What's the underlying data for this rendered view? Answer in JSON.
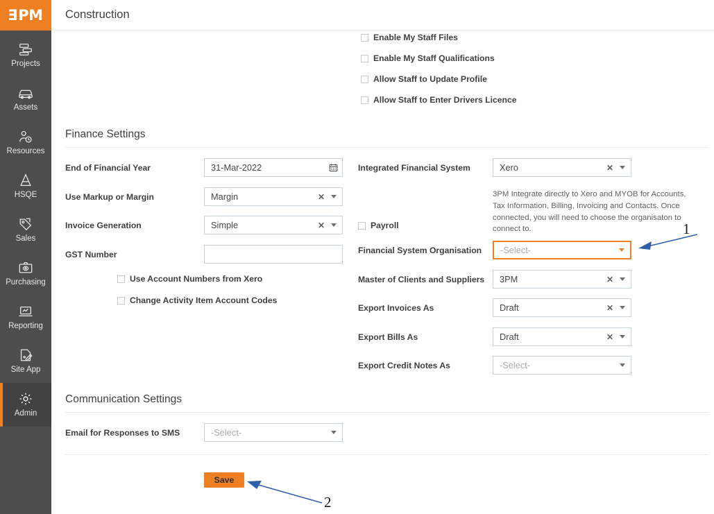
{
  "brand": {
    "logo": "3PM",
    "accent": "#ee8023",
    "sidebar_bg": "#4d4d4d"
  },
  "header": {
    "title": "Construction"
  },
  "sidebar": {
    "items": [
      {
        "label": "Projects",
        "icon": "projects-icon",
        "active": false
      },
      {
        "label": "Assets",
        "icon": "assets-icon",
        "active": false
      },
      {
        "label": "Resources",
        "icon": "resources-icon",
        "active": false
      },
      {
        "label": "HSQE",
        "icon": "hsqe-icon",
        "active": false
      },
      {
        "label": "Sales",
        "icon": "sales-icon",
        "active": false
      },
      {
        "label": "Purchasing",
        "icon": "purchasing-icon",
        "active": false
      },
      {
        "label": "Reporting",
        "icon": "reporting-icon",
        "active": false
      },
      {
        "label": "Site App",
        "icon": "site-app-icon",
        "active": false
      },
      {
        "label": "Admin",
        "icon": "gear-icon",
        "active": true
      }
    ]
  },
  "staff_settings": {
    "checkboxes": [
      {
        "label": "Enable My Staff Files",
        "checked": false
      },
      {
        "label": "Enable My Staff Qualifications",
        "checked": false
      },
      {
        "label": "Allow Staff to Update Profile",
        "checked": false
      },
      {
        "label": "Allow Staff to Enter Drivers Licence",
        "checked": false
      }
    ]
  },
  "finance": {
    "heading": "Finance Settings",
    "left": {
      "end_of_financial_year": {
        "label": "End of Financial Year",
        "value": "31-Mar-2022"
      },
      "markup_or_margin": {
        "label": "Use Markup or Margin",
        "value": "Margin"
      },
      "invoice_generation": {
        "label": "Invoice Generation",
        "value": "Simple"
      },
      "gst_number": {
        "label": "GST Number",
        "value": "",
        "placeholder": ""
      },
      "checkboxes": [
        {
          "label": "Use Account Numbers from Xero",
          "checked": false
        },
        {
          "label": "Change Activity Item Account Codes",
          "checked": false
        }
      ]
    },
    "right": {
      "integrated_financial_system": {
        "label": "Integrated Financial System",
        "value": "Xero"
      },
      "help_text": "3PM Integrate directly to Xero and MYOB for Accounts, Tax Information, Billing, Invoicing and Contacts. Once connected, you will need to choose the organisaton to connect to.",
      "payroll": {
        "label": "Payroll",
        "checked": false
      },
      "financial_system_organisation": {
        "label": "Financial System Organisation",
        "value": "-Select-",
        "is_placeholder": true,
        "focused": true
      },
      "master_of_clients": {
        "label": "Master of Clients and Suppliers",
        "value": "3PM"
      },
      "export_invoices_as": {
        "label": "Export Invoices As",
        "value": "Draft"
      },
      "export_bills_as": {
        "label": "Export Bills As",
        "value": "Draft"
      },
      "export_credit_notes": {
        "label": "Export Credit Notes As",
        "value": "-Select-",
        "is_placeholder": true
      }
    }
  },
  "communication": {
    "heading": "Communication Settings",
    "email_for_sms": {
      "label": "Email for Responses to SMS",
      "value": "-Select-",
      "is_placeholder": true
    }
  },
  "actions": {
    "save_label": "Save"
  },
  "annotations": [
    {
      "number": "1",
      "target": "financial-system-organisation-select"
    },
    {
      "number": "2",
      "target": "save-button"
    }
  ]
}
